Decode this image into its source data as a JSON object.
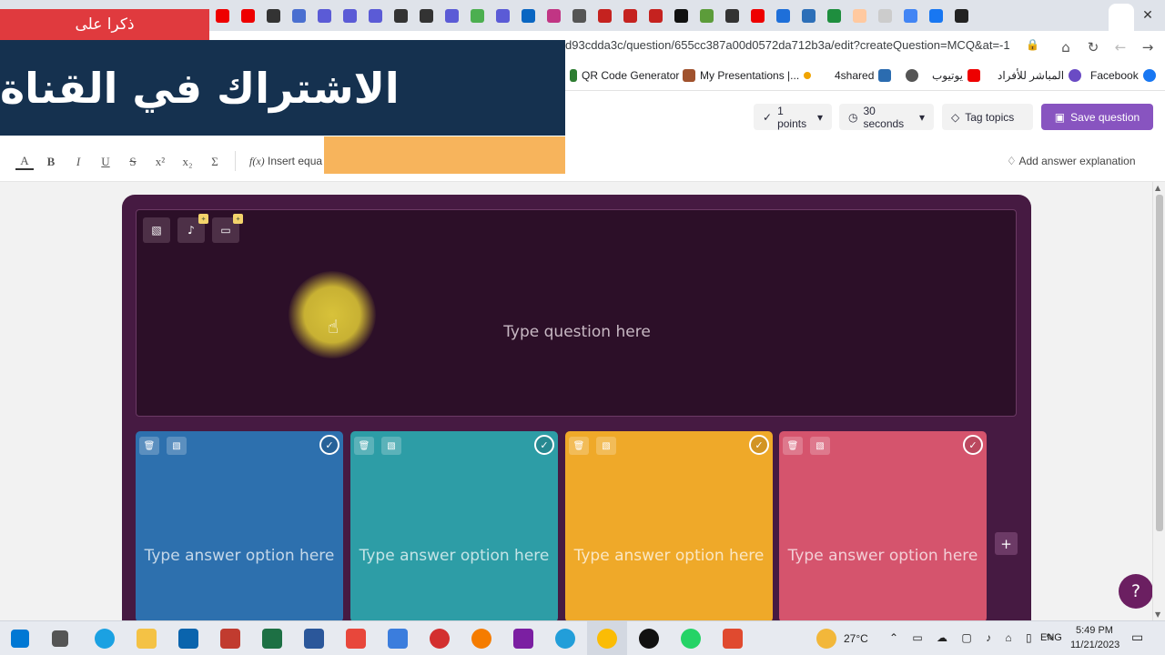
{
  "browser": {
    "url": "d93cdda3c/question/655cc387a00d0572da712b3a/edit?createQuestion=MCQ&at=-1",
    "bookmarks": [
      "QR Code Generator",
      "My Presentations |...",
      "4shared",
      "يوتيوب",
      "المباشر للأفراد",
      "Facebook"
    ]
  },
  "overlay": {
    "small_label": "ذكرا على",
    "headline": "الاشتراك في القناة"
  },
  "quiz_toolbar": {
    "points": "1 points",
    "time": "30 seconds",
    "tag_topics": "Tag topics",
    "save": "Save question"
  },
  "format_bar": {
    "insert_equation": "Insert equa",
    "add_explanation": "Add answer explanation"
  },
  "question": {
    "placeholder": "Type question here"
  },
  "options": [
    {
      "text": "Type answer option here",
      "color": "#2d70ae"
    },
    {
      "text": "Type answer option here",
      "color": "#2d9da6"
    },
    {
      "text": "Type answer option here",
      "color": "#efa929"
    },
    {
      "text": "Type answer option here",
      "color": "#d5546d"
    }
  ],
  "taskbar": {
    "temperature": "27°C",
    "language": "ENG",
    "time": "5:49 PM",
    "date": "11/21/2023"
  },
  "colors": {
    "accent": "#8854c0",
    "card_bg": "#461a42",
    "question_bg": "#2c0f28"
  }
}
